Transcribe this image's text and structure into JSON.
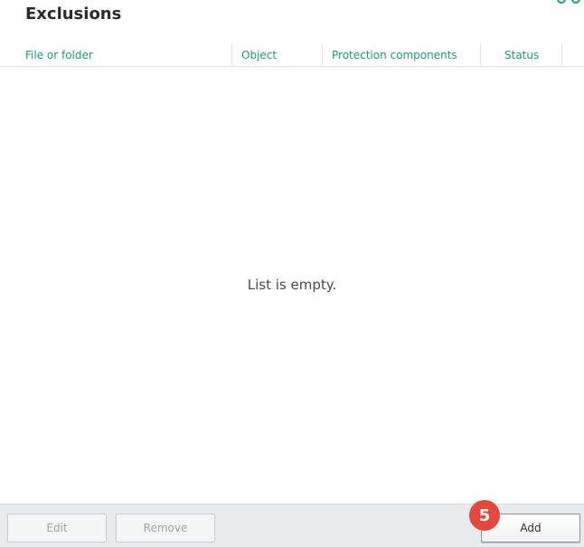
{
  "page": {
    "title": "Exclusions"
  },
  "table": {
    "columns": [
      {
        "label": "File or folder"
      },
      {
        "label": "Object"
      },
      {
        "label": "Protection components"
      },
      {
        "label": "Status"
      }
    ],
    "empty_message": "List is empty."
  },
  "footer": {
    "edit_label": "Edit",
    "remove_label": "Remove",
    "add_label": "Add"
  },
  "annotation": {
    "step_number": "5"
  },
  "icons": {
    "top_right": [
      "help-icon",
      "settings-icon"
    ]
  },
  "colors": {
    "accent": "#1a9b81",
    "badge": "#e5473b"
  }
}
